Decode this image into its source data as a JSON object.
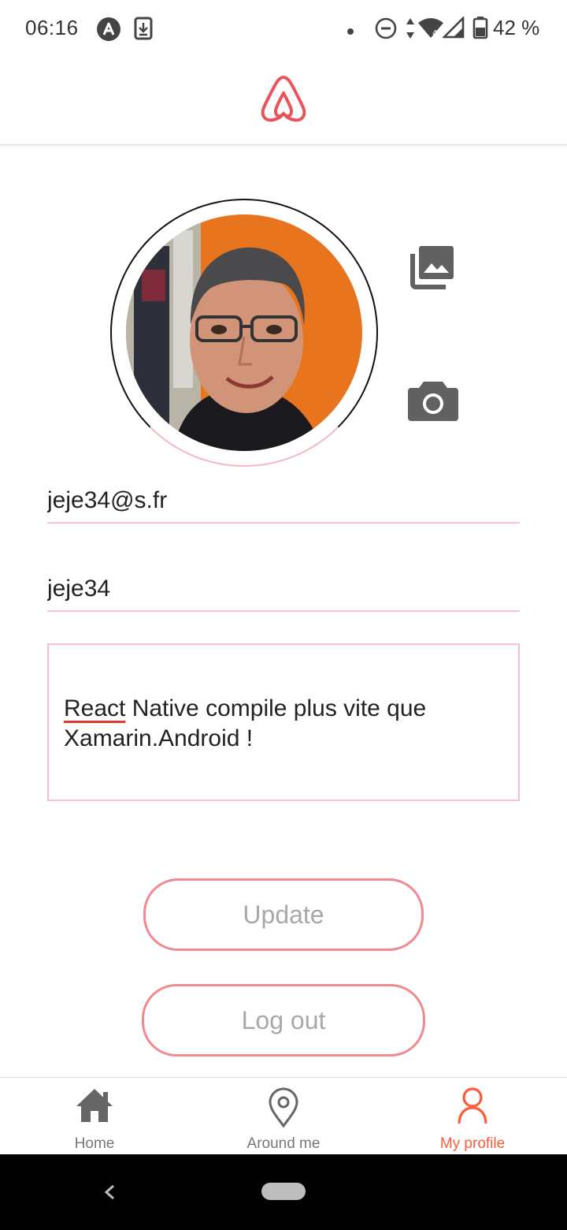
{
  "status_bar": {
    "time": "06:16",
    "battery_text": "42 %",
    "icons": [
      "app-notification-icon",
      "download-icon",
      "dot-icon",
      "do-not-disturb-icon",
      "data-arrows-icon",
      "wifi-icon",
      "signal-icon",
      "battery-icon"
    ]
  },
  "header": {
    "logo": "airbnb-logo",
    "accent_color": "#e8545a"
  },
  "profile": {
    "avatar": "profile-photo",
    "gallery_icon": "photo-library-icon",
    "camera_icon": "camera-icon"
  },
  "form": {
    "email_value": "jeje34@s.fr",
    "username_value": "jeje34",
    "description_first_word": "React",
    "description_rest": " Native compile plus vite que Xamarin.Android !",
    "border_color": "#f7c1c7"
  },
  "buttons": {
    "update_label": "Update",
    "logout_label": "Log out",
    "border_color": "#f08a8f"
  },
  "tabs": [
    {
      "label": "Home",
      "icon": "home-icon",
      "active": false
    },
    {
      "label": "Around me",
      "icon": "location-pin-icon",
      "active": false
    },
    {
      "label": "My profile",
      "icon": "user-icon",
      "active": true
    }
  ],
  "active_tab_color": "#ff5a3a"
}
